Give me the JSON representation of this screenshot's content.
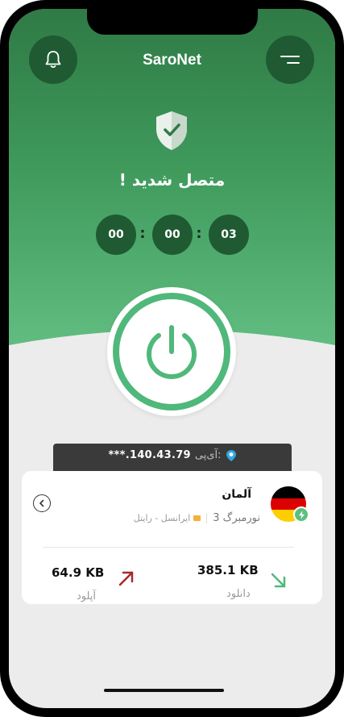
{
  "header": {
    "title": "SaroNet",
    "bell_icon": "bell-icon",
    "menu_icon": "menu-icon"
  },
  "connection": {
    "status": "متصل شدید !",
    "shield_icon": "shield-check-icon",
    "timer": {
      "hours": "00",
      "minutes": "00",
      "seconds": "03",
      "separator": ":"
    },
    "power_icon": "power-icon"
  },
  "ip": {
    "label": "آی‌پی:",
    "value": "***.140.43.79",
    "icon": "ip-pin-icon"
  },
  "server": {
    "country": "آلمان",
    "city": "نورمبرگ 3",
    "isp": "ایرانسل - رایتل",
    "flag_icon": "germany-flag-icon",
    "bolt_icon": "bolt-icon",
    "back_icon": "chevron-left-icon"
  },
  "stats": {
    "download_value": "385.1 KB",
    "download_label": "دانلود",
    "upload_value": "64.9 KB",
    "upload_label": "آپلود",
    "download_icon": "arrow-down-right-icon",
    "upload_icon": "arrow-up-right-icon"
  },
  "colors": {
    "accent_green": "#3f9a5c",
    "dark_green": "#1f5a33",
    "upload_red": "#a52a2a",
    "download_green": "#4fb87a"
  }
}
